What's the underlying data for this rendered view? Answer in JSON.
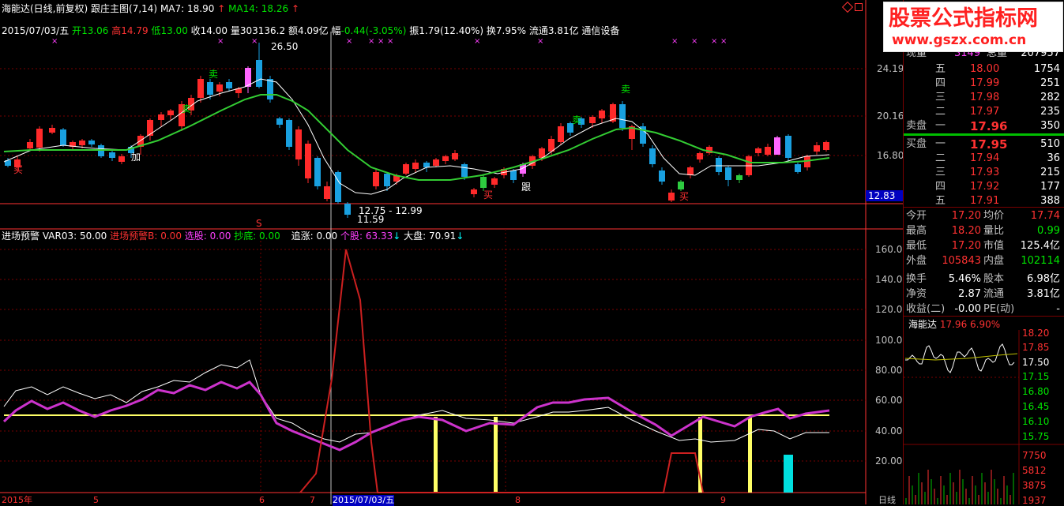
{
  "chart_header": {
    "title": "海能达(日线,前复权)",
    "indicator": "跟庄主图(7,14)",
    "ma7": "MA7: 18.90",
    "ma14": "MA14: 18.26",
    "arrow": "↑"
  },
  "ohlc_line": {
    "date": "2015/07/03/五",
    "open_label": "开",
    "open": "13.06",
    "high_label": "高",
    "high": "14.79",
    "low_label": "低",
    "low": "13.00",
    "close_label": "收",
    "close": "14.00",
    "volume": "量303136.2",
    "amount": "额4.09亿",
    "change_label": "幅",
    "change": "-0.44(-3.05%)",
    "amplitude": "振1.79(12.40%)",
    "turnover": "换7.95%",
    "float_mv": "流通3.81亿",
    "industry": "通信设备"
  },
  "main_price_axis": [
    "24.19",
    "20.16",
    "16.80"
  ],
  "current_price_marker": "12.83",
  "annotations": {
    "high_label": "26.50",
    "low_range": "12.75 - 12.99",
    "low_label": "11.59",
    "buy": "买",
    "sell": "卖",
    "add": "加",
    "follow": "跟",
    "s_mark": "S",
    "x_mark": "×"
  },
  "sub_header": {
    "name": "进场预警",
    "var03": "VAR03: 50.00",
    "warn_b": "进场预警B: 0.00",
    "pick": "选股: 0.00",
    "bottom": "抄底: 0.00",
    "chase": "追涨: 0.00",
    "stock": "个股: 63.33",
    "market": "大盘: 70.91",
    "down_arrow": "↓"
  },
  "sub_axis": [
    "160.00",
    "140.00",
    "120.00",
    "100.00",
    "80.00",
    "60.00",
    "40.00",
    "20.00"
  ],
  "date_axis": [
    "2015年",
    "5",
    "6",
    "7",
    "2015/07/03/五",
    "8",
    "9",
    "日线"
  ],
  "watermark": {
    "title": "股票公式指标网",
    "url": "www.gszx.com.cn"
  },
  "quote": {
    "now_label": "现量",
    "now_value": "3149",
    "total_label": "总量",
    "total_value": "207957",
    "sell_label": "卖盘",
    "buy_label": "买盘",
    "asks": [
      {
        "level": "五",
        "price": "18.00",
        "vol": "1754"
      },
      {
        "level": "四",
        "price": "17.99",
        "vol": "251"
      },
      {
        "level": "三",
        "price": "17.98",
        "vol": "282"
      },
      {
        "level": "二",
        "price": "17.97",
        "vol": "235"
      },
      {
        "level": "一",
        "price": "17.96",
        "vol": "350"
      }
    ],
    "bids": [
      {
        "level": "一",
        "price": "17.95",
        "vol": "510"
      },
      {
        "level": "二",
        "price": "17.94",
        "vol": "36"
      },
      {
        "level": "三",
        "price": "17.93",
        "vol": "215"
      },
      {
        "level": "四",
        "price": "17.92",
        "vol": "177"
      },
      {
        "level": "五",
        "price": "17.91",
        "vol": "388"
      }
    ],
    "stats": [
      {
        "l1": "今开",
        "v1": "17.20",
        "l2": "均价",
        "v2": "17.74",
        "c1": "r",
        "c2": "r"
      },
      {
        "l1": "最高",
        "v1": "18.20",
        "l2": "量比",
        "v2": "0.99",
        "c1": "r",
        "c2": "g"
      },
      {
        "l1": "最低",
        "v1": "17.20",
        "l2": "市值",
        "v2": "125.4亿",
        "c1": "r",
        "c2": "w"
      },
      {
        "l1": "外盘",
        "v1": "105843",
        "l2": "内盘",
        "v2": "102114",
        "c1": "r",
        "c2": "g"
      },
      {
        "l1": "换手",
        "v1": "5.46%",
        "l2": "股本",
        "v2": "6.98亿",
        "c1": "w",
        "c2": "w"
      },
      {
        "l1": "净资",
        "v1": "2.87",
        "l2": "流通",
        "v2": "3.81亿",
        "c1": "w",
        "c2": "w"
      },
      {
        "l1": "收益(二)",
        "v1": "-0.00",
        "l2": "PE(动)",
        "v2": "-",
        "c1": "w",
        "c2": "w"
      }
    ],
    "mini_title": "海能达",
    "mini_price": "17.96",
    "mini_pct": "6.90%",
    "mini_axis": [
      "18.20",
      "17.85",
      "17.50",
      "17.15",
      "16.80",
      "16.45",
      "16.10",
      "15.75"
    ],
    "mini_vol_axis": [
      "7750",
      "5812",
      "3875",
      "1937"
    ]
  }
}
